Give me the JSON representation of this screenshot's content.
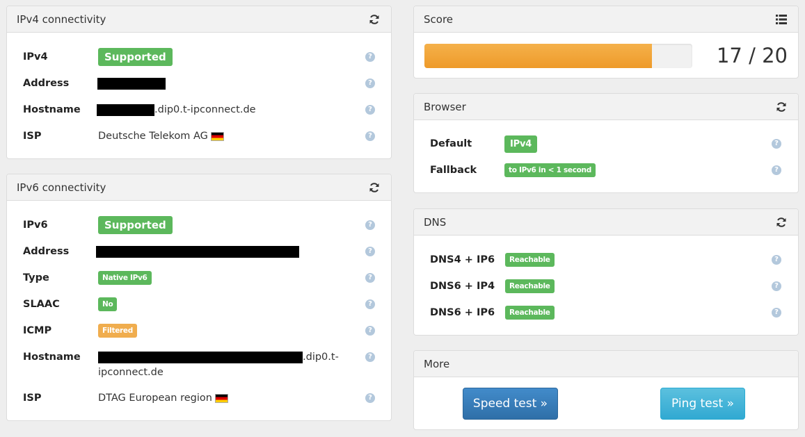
{
  "ipv4": {
    "title": "IPv4 connectivity",
    "rows": [
      {
        "label": "IPv4",
        "value": "Supported"
      },
      {
        "label": "Address",
        "value": ""
      },
      {
        "label": "Hostname",
        "value": ".dip0.t-ipconnect.de"
      },
      {
        "label": "ISP",
        "value": "Deutsche Telekom AG"
      }
    ],
    "flag": "flag-germany-icon"
  },
  "ipv6": {
    "title": "IPv6 connectivity",
    "rows": [
      {
        "label": "IPv6",
        "value": "Supported"
      },
      {
        "label": "Address",
        "value": ""
      },
      {
        "label": "Type",
        "value": "Native IPv6"
      },
      {
        "label": "SLAAC",
        "value": "No"
      },
      {
        "label": "ICMP",
        "value": "Filtered"
      },
      {
        "label": "Hostname",
        "value": ".dip0.t-",
        "value_line2": "ipconnect.de"
      },
      {
        "label": "ISP",
        "value": "DTAG European region"
      }
    ]
  },
  "score": {
    "title": "Score",
    "value": 17,
    "max": 20,
    "text": "17 / 20"
  },
  "browser": {
    "title": "Browser",
    "rows": [
      {
        "label": "Default",
        "value": "IPv4"
      },
      {
        "label": "Fallback",
        "value": "to IPv6 in < 1 second"
      }
    ]
  },
  "dns": {
    "title": "DNS",
    "rows": [
      {
        "label": "DNS4 + IP6",
        "value": "Reachable"
      },
      {
        "label": "DNS6 + IP4",
        "value": "Reachable"
      },
      {
        "label": "DNS6 + IP6",
        "value": "Reachable"
      }
    ]
  },
  "more": {
    "title": "More",
    "speed_test": "Speed test »",
    "ping_test": "Ping test »"
  },
  "help_glyph": "?",
  "colors": {
    "success": "#5cb85c",
    "warning": "#f0ad4e",
    "primary": "#428bca",
    "info": "#5bc0de",
    "progress": "#f0a030"
  }
}
